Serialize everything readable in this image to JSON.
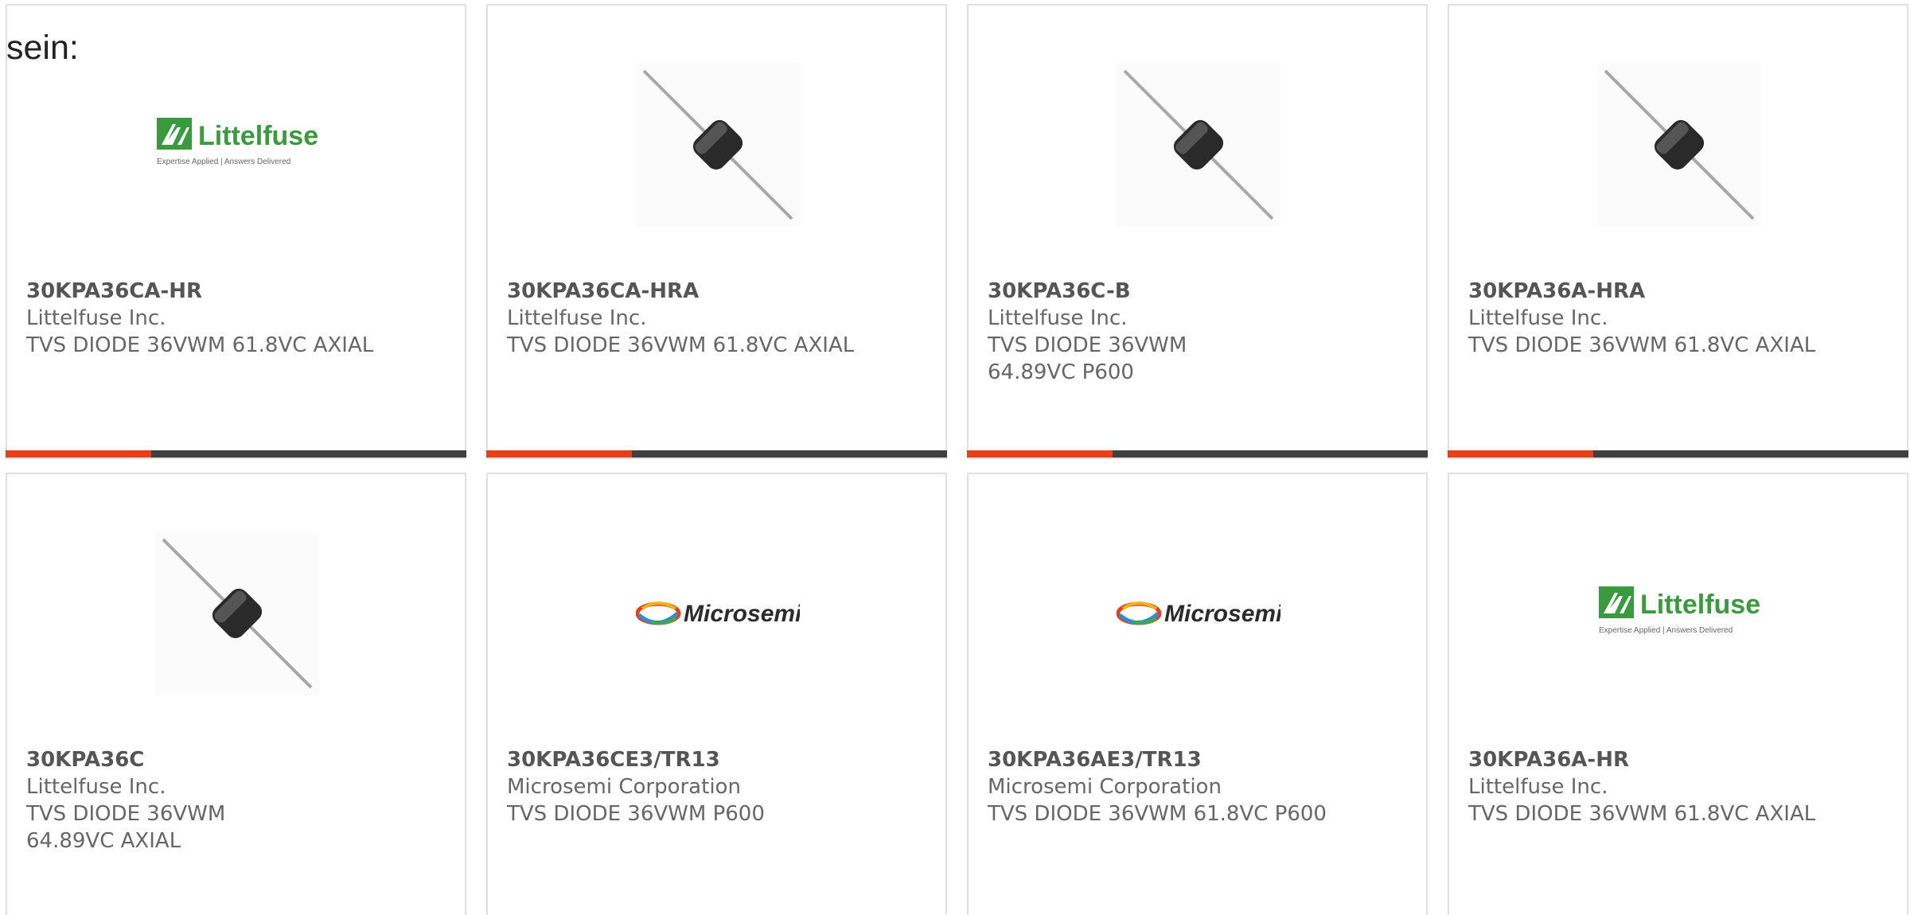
{
  "intro_text": "sein:",
  "brand_colors": {
    "accent": "#e5401a",
    "bar": "#404040",
    "littelfuse_green": "#3a9a3e"
  },
  "logos": {
    "littelfuse": {
      "name": "Littelfuse",
      "tagline": "Expertise Applied | Answers Delivered"
    },
    "microsemi": {
      "name": "Microsemi"
    }
  },
  "products": [
    {
      "part": "30KPA36CA-HR",
      "manufacturer": "Littelfuse Inc.",
      "description": "TVS DIODE 36VWM 61.8VC AXIAL",
      "image": "littelfuse-logo"
    },
    {
      "part": "30KPA36CA-HRA",
      "manufacturer": "Littelfuse Inc.",
      "description": "TVS DIODE 36VWM 61.8VC AXIAL",
      "image": "axial-diode-photo"
    },
    {
      "part": "30KPA36C-B",
      "manufacturer": "Littelfuse Inc.",
      "description": "TVS DIODE 36VWM 64.89VC P600",
      "image": "axial-diode-photo"
    },
    {
      "part": "30KPA36A-HRA",
      "manufacturer": "Littelfuse Inc.",
      "description": "TVS DIODE 36VWM 61.8VC AXIAL",
      "image": "axial-diode-photo"
    },
    {
      "part": "30KPA36C",
      "manufacturer": "Littelfuse Inc.",
      "description": "TVS DIODE 36VWM 64.89VC AXIAL",
      "image": "axial-diode-photo"
    },
    {
      "part": "30KPA36CE3/TR13",
      "manufacturer": "Microsemi Corporation",
      "description": "TVS DIODE 36VWM P600",
      "image": "microsemi-logo"
    },
    {
      "part": "30KPA36AE3/TR13",
      "manufacturer": "Microsemi Corporation",
      "description": "TVS DIODE 36VWM 61.8VC P600",
      "image": "microsemi-logo"
    },
    {
      "part": "30KPA36A-HR",
      "manufacturer": "Littelfuse Inc.",
      "description": "TVS DIODE 36VWM 61.8VC AXIAL",
      "image": "littelfuse-logo"
    }
  ]
}
